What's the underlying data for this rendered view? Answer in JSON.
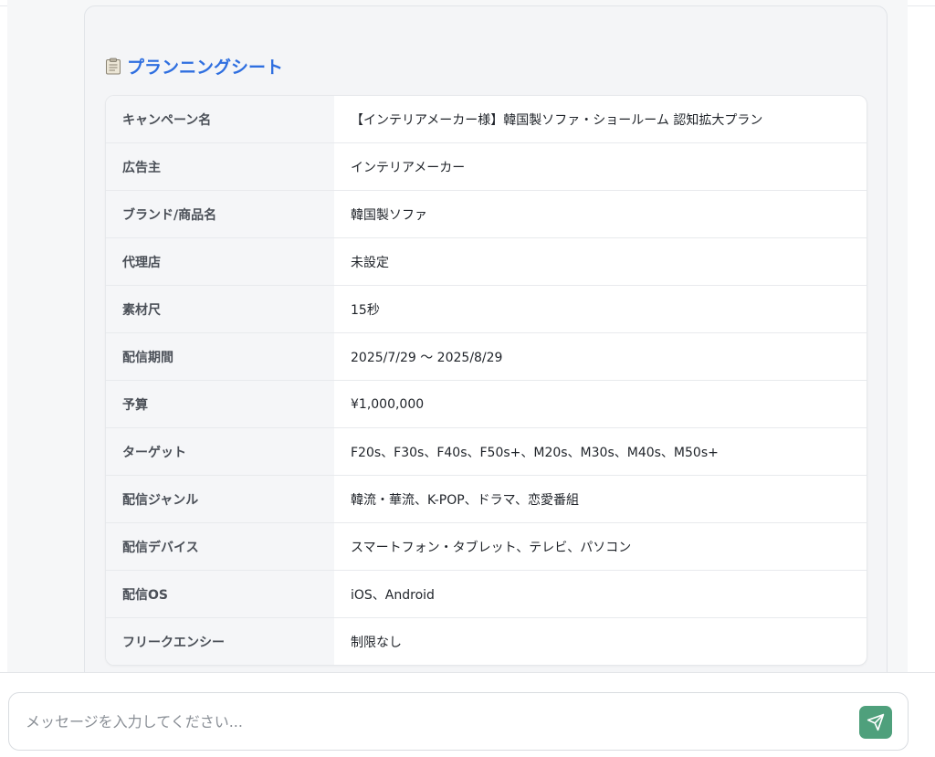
{
  "planning_sheet": {
    "title": "プランニングシート",
    "title_icon": "clipboard-icon",
    "title_color": "#2f6fe0",
    "rows": [
      {
        "label": "キャンペーン名",
        "value": "【インテリアメーカー様】韓国製ソファ・ショールーム 認知拡大プラン"
      },
      {
        "label": "広告主",
        "value": "インテリアメーカー"
      },
      {
        "label": "ブランド/商品名",
        "value": "韓国製ソファ"
      },
      {
        "label": "代理店",
        "value": "未設定"
      },
      {
        "label": "素材尺",
        "value": "15秒"
      },
      {
        "label": "配信期間",
        "value": "2025/7/29 〜 2025/8/29"
      },
      {
        "label": "予算",
        "value": "¥1,000,000"
      },
      {
        "label": "ターゲット",
        "value": "F20s、F30s、F40s、F50s+、M20s、M30s、M40s、M50s+"
      },
      {
        "label": "配信ジャンル",
        "value": "韓流・華流、K-POP、ドラマ、恋愛番組"
      },
      {
        "label": "配信デバイス",
        "value": "スマートフォン・タブレット、テレビ、パソコン"
      },
      {
        "label": "配信OS",
        "value": "iOS、Android"
      },
      {
        "label": "フリークエンシー",
        "value": "制限なし"
      }
    ]
  },
  "composer": {
    "placeholder": "メッセージを入力してください...",
    "value": "",
    "send_icon": "send-icon",
    "send_color": "#4fa07c"
  }
}
